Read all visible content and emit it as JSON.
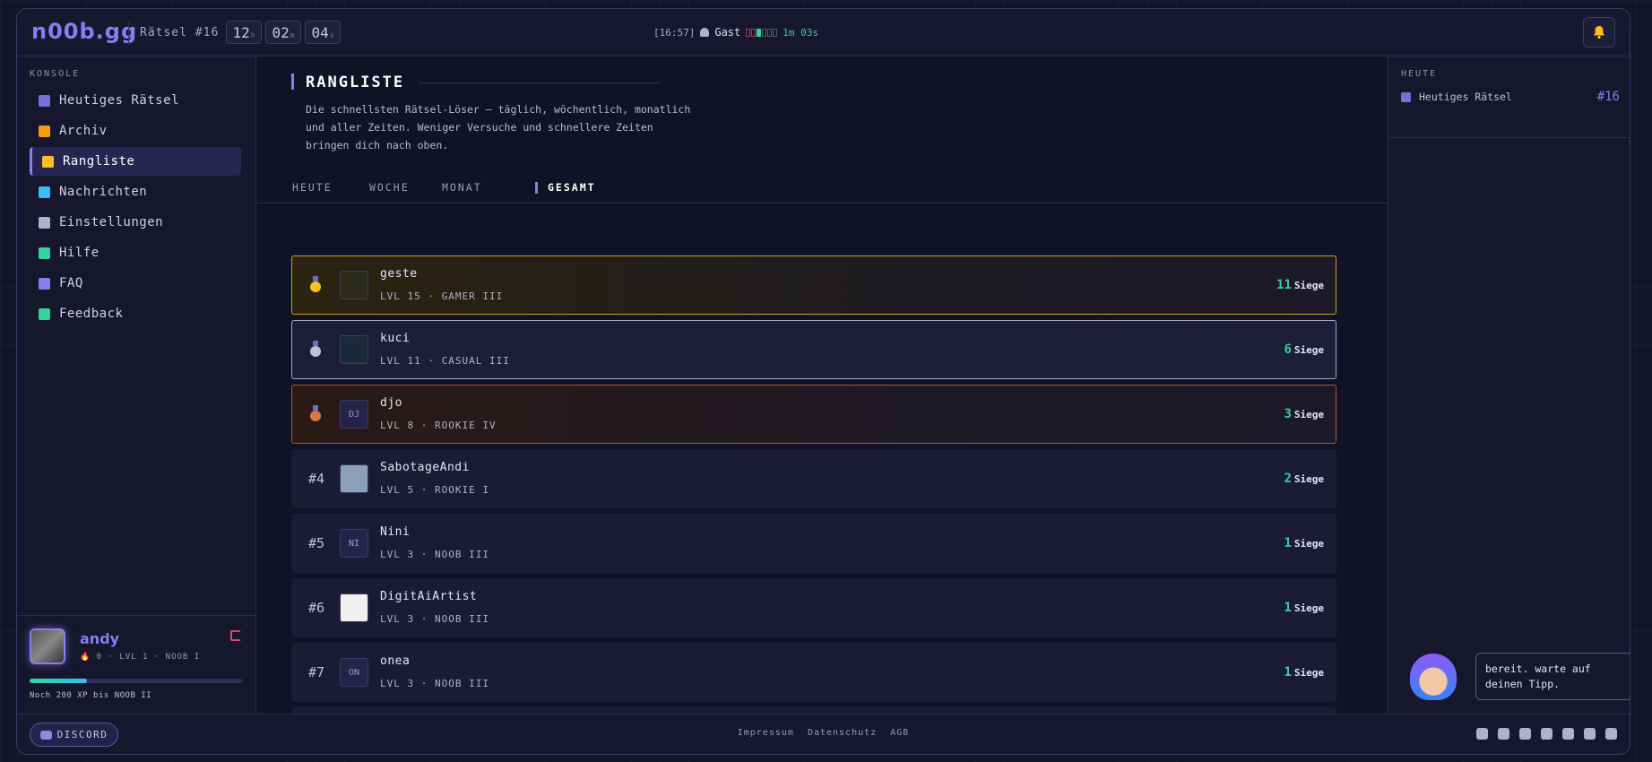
{
  "header": {
    "logo": "n00b.gg",
    "puzzle": "Rätsel #16",
    "timer": [
      {
        "value": "12",
        "unit": "h"
      },
      {
        "value": "02",
        "unit": "m"
      },
      {
        "value": "04",
        "unit": "s"
      }
    ],
    "clock": "[16:57]",
    "user": "Gast",
    "elapsed": "1m 03s"
  },
  "sidebar": {
    "section": "KONSOLE",
    "items": [
      {
        "label": "Heutiges Rätsel",
        "icon": "puzzle-icon",
        "color": "#7c6cd8"
      },
      {
        "label": "Archiv",
        "icon": "archive-icon",
        "color": "#f59e0b"
      },
      {
        "label": "Rangliste",
        "icon": "trophy-icon",
        "color": "#fbbf24"
      },
      {
        "label": "Nachrichten",
        "icon": "inbox-icon",
        "color": "#38bdf8"
      },
      {
        "label": "Einstellungen",
        "icon": "gear-icon",
        "color": "#b0b0d0"
      },
      {
        "label": "Hilfe",
        "icon": "help-stack-icon",
        "color": "#34d399"
      },
      {
        "label": "FAQ",
        "icon": "question-icon",
        "color": "#8b7cf0"
      },
      {
        "label": "Feedback",
        "icon": "chat-icon",
        "color": "#34d399"
      }
    ],
    "user": {
      "name": "andy",
      "stats": "🔥 0 · LVL 1 · NOOB I",
      "xp_progress": 0.27,
      "xp_text": "Noch 200 XP bis NOOB II"
    }
  },
  "main": {
    "title": "RANGLISTE",
    "description": "Die schnellsten Rätsel-Löser — täglich, wöchentlich, monatlich und aller Zeiten. Weniger Versuche und schnellere Zeiten bringen dich nach oben.",
    "tabs": [
      "HEUTE",
      "WOCHE",
      "MONAT",
      "GESAMT"
    ],
    "wins_label": "Siege",
    "rows": [
      {
        "rank": "1",
        "name": "geste",
        "level": "LVL 15 · GAMER III",
        "wins": "11",
        "avatar": ""
      },
      {
        "rank": "2",
        "name": "kuci",
        "level": "LVL 11 · CASUAL III",
        "wins": "6",
        "avatar": ""
      },
      {
        "rank": "3",
        "name": "djo",
        "level": "LVL 8 · ROOKIE IV",
        "wins": "3",
        "avatar": "DJ"
      },
      {
        "rank": "#4",
        "name": "SabotageAndi",
        "level": "LVL 5 · ROOKIE I",
        "wins": "2",
        "avatar": ""
      },
      {
        "rank": "#5",
        "name": "Nini",
        "level": "LVL 3 · NOOB III",
        "wins": "1",
        "avatar": "NI"
      },
      {
        "rank": "#6",
        "name": "DigitAiArtist",
        "level": "LVL 3 · NOOB III",
        "wins": "1",
        "avatar": ""
      },
      {
        "rank": "#7",
        "name": "onea",
        "level": "LVL 3 · NOOB III",
        "wins": "1",
        "avatar": "ON"
      }
    ]
  },
  "right": {
    "section": "HEUTE",
    "item": "Heutiges Rätsel",
    "number": "#16",
    "bubble": "bereit. warte auf deinen Tipp."
  },
  "footer": {
    "discord": "DISCORD",
    "links": [
      "Impressum",
      "Datenschutz",
      "AGB"
    ],
    "social": [
      "tiktok-icon",
      "youtube-icon",
      "instagram-icon",
      "reddit-icon",
      "threads-icon",
      "discord-icon",
      "twitch-icon"
    ]
  }
}
